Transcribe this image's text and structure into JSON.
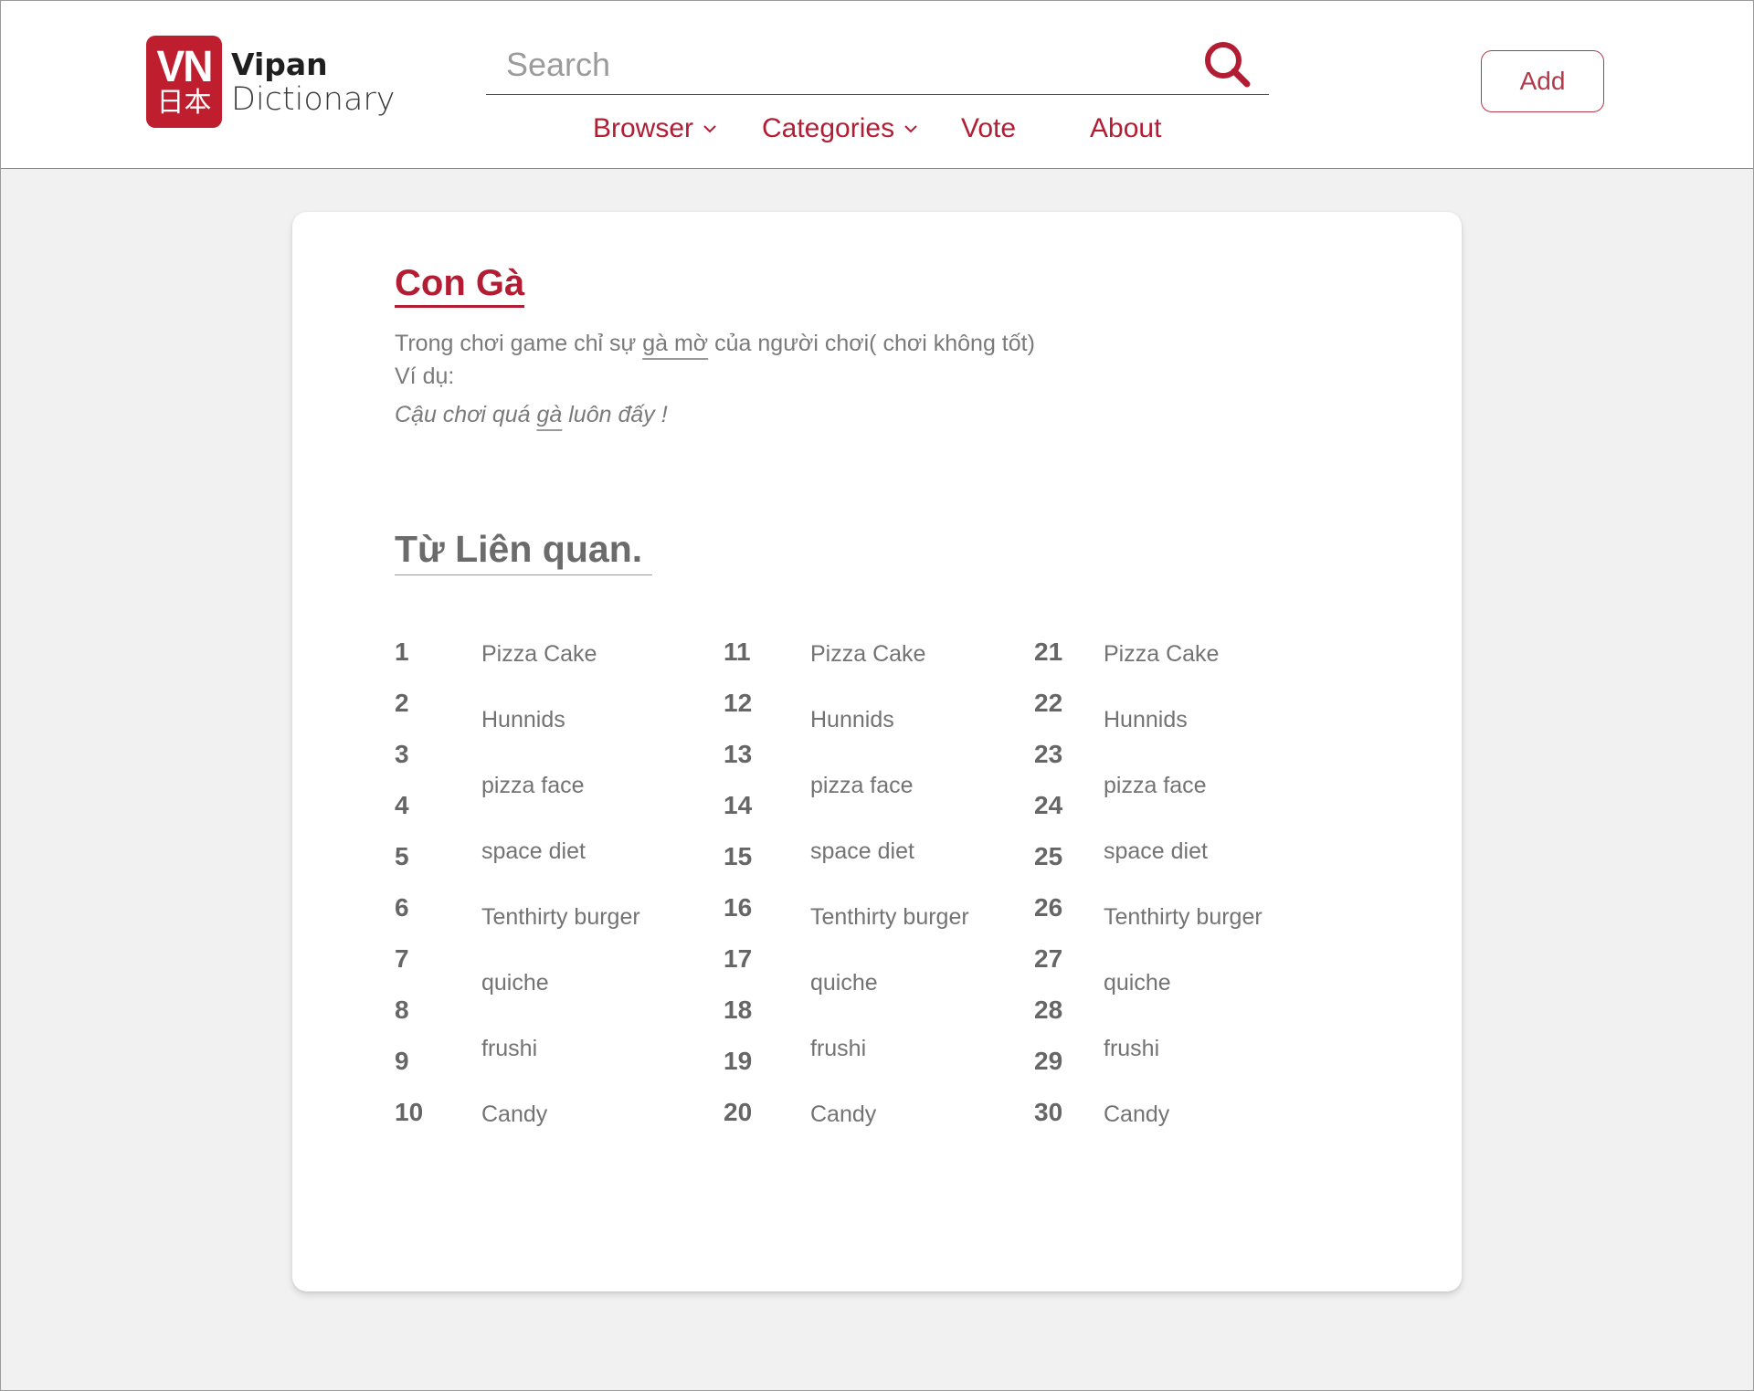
{
  "brand": {
    "badge_top": "VN",
    "badge_bottom": "日本",
    "name_line1": "Vipan",
    "name_line2": "Dictionary",
    "accent_color": "#bf1e2e"
  },
  "search": {
    "placeholder": "Search",
    "value": ""
  },
  "nav": {
    "items": [
      {
        "label": "Browser",
        "has_dropdown": true
      },
      {
        "label": "Categories",
        "has_dropdown": true
      },
      {
        "label": "Vote",
        "has_dropdown": false
      },
      {
        "label": "About",
        "has_dropdown": false
      }
    ]
  },
  "actions": {
    "add_label": "Add"
  },
  "entry": {
    "title": "Con Gà",
    "definition_before": "Trong chơi game chỉ sự ",
    "definition_link": "gà mờ",
    "definition_after": " của người chơi( chơi không tốt)",
    "example_label": "Ví dụ:",
    "example_before": "Cậu chơi quá ",
    "example_link": "gà",
    "example_after": " luôn đấy !"
  },
  "related": {
    "title": "Từ Liên quan.",
    "numbers": [
      "1",
      "2",
      "3",
      "4",
      "5",
      "6",
      "7",
      "8",
      "9",
      "10",
      "11",
      "12",
      "13",
      "14",
      "15",
      "16",
      "17",
      "18",
      "19",
      "20",
      "21",
      "22",
      "23",
      "24",
      "25",
      "26",
      "27",
      "28",
      "29",
      "30"
    ],
    "terms": [
      "Pizza Cake",
      "Hunnids",
      "pizza face",
      "space diet",
      "Tenthirty burger",
      "quiche",
      "frushi",
      "Candy",
      "Pizza Cake",
      "Hunnids",
      "pizza face",
      "space diet",
      "Tenthirty burger",
      "quiche",
      "frushi",
      "Candy",
      "Pizza Cake",
      "Hunnids",
      "pizza face",
      "space diet",
      "Tenthirty burger",
      "quiche",
      "frushi",
      "Candy"
    ]
  }
}
